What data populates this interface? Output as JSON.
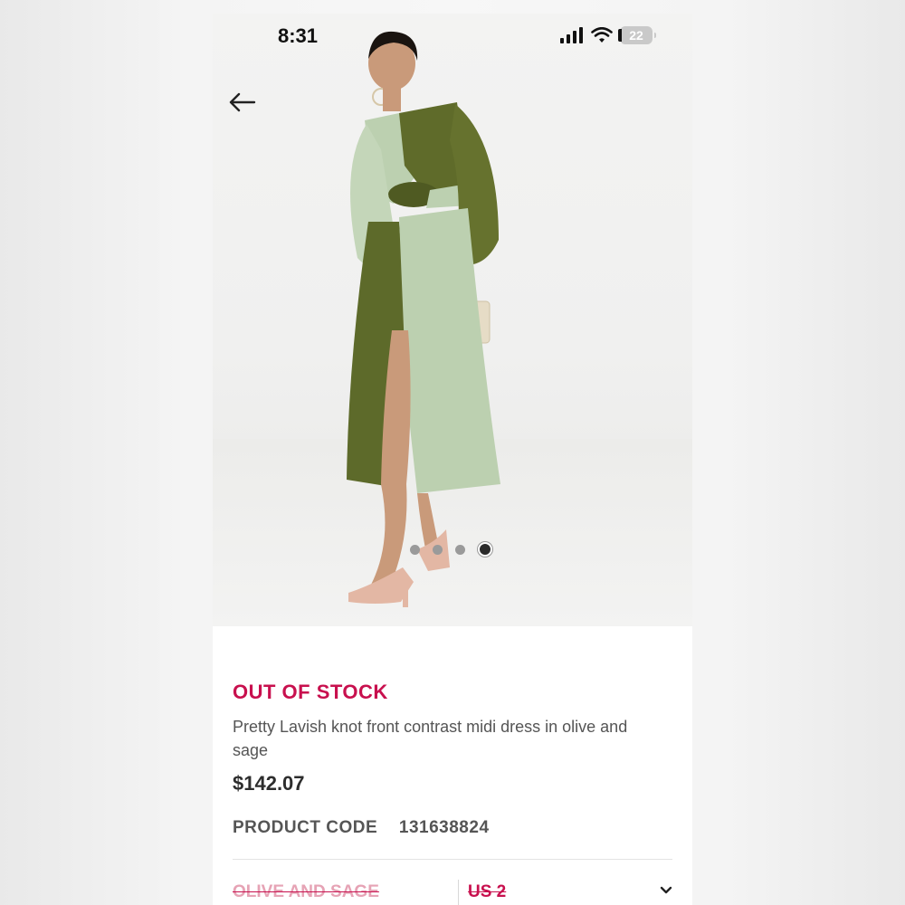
{
  "status_bar": {
    "time": "8:31",
    "battery": "22"
  },
  "hero": {
    "description_icon": "product-photo",
    "carousel": {
      "count": 4,
      "active_index": 3
    }
  },
  "product": {
    "stock_status": "OUT OF STOCK",
    "title": "Pretty Lavish knot front contrast midi dress in olive and sage",
    "price": "$142.07",
    "code_label": "PRODUCT CODE",
    "code_value": "131638824"
  },
  "options": {
    "color": "OLIVE AND SAGE",
    "size": "US 2"
  },
  "colors": {
    "accent": "#c8104e",
    "olive": "#5f6b2a",
    "sage": "#bcd0b0"
  }
}
